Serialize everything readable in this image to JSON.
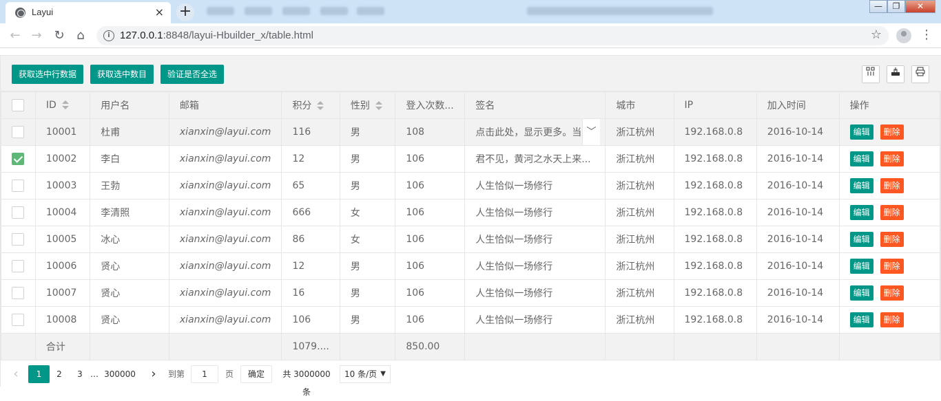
{
  "browser": {
    "tab_title": "Layui",
    "tab_close": "×",
    "new_tab": "+",
    "url_host": "127.0.0.1",
    "url_rest": ":8848/layui-Hbuilder_x/table.html",
    "win_min": "—",
    "win_max": "❐",
    "win_close": "✕"
  },
  "toolbar": {
    "btn_get_checked_data": "获取选中行数据",
    "btn_get_checked_count": "获取选中数目",
    "btn_check_all": "验证是否全选",
    "icon_filter": "filter-columns-icon",
    "icon_export": "export-icon",
    "icon_print": "print-icon"
  },
  "table": {
    "headers": [
      "ID",
      "用户名",
      "邮箱",
      "积分",
      "性别",
      "登入次数...",
      "签名",
      "城市",
      "IP",
      "加入时间",
      "操作"
    ],
    "rows": [
      {
        "checked": false,
        "id": "10001",
        "username": "杜甫",
        "email": "xianxin@layui.com",
        "score": "116",
        "sex": "男",
        "logins": "108",
        "sign": "点击此处，显示更多。当...",
        "city": "浙江杭州",
        "ip": "192.168.0.8",
        "joined": "2016-10-14"
      },
      {
        "checked": true,
        "id": "10002",
        "username": "李白",
        "email": "xianxin@layui.com",
        "score": "12",
        "sex": "男",
        "logins": "106",
        "sign": "君不见，黄河之水天上来...",
        "city": "浙江杭州",
        "ip": "192.168.0.8",
        "joined": "2016-10-14"
      },
      {
        "checked": false,
        "id": "10003",
        "username": "王勃",
        "email": "xianxin@layui.com",
        "score": "65",
        "sex": "男",
        "logins": "106",
        "sign": "人生恰似一场修行",
        "city": "浙江杭州",
        "ip": "192.168.0.8",
        "joined": "2016-10-14"
      },
      {
        "checked": false,
        "id": "10004",
        "username": "李清照",
        "email": "xianxin@layui.com",
        "score": "666",
        "sex": "女",
        "logins": "106",
        "sign": "人生恰似一场修行",
        "city": "浙江杭州",
        "ip": "192.168.0.8",
        "joined": "2016-10-14"
      },
      {
        "checked": false,
        "id": "10005",
        "username": "冰心",
        "email": "xianxin@layui.com",
        "score": "86",
        "sex": "女",
        "logins": "106",
        "sign": "人生恰似一场修行",
        "city": "浙江杭州",
        "ip": "192.168.0.8",
        "joined": "2016-10-14"
      },
      {
        "checked": false,
        "id": "10006",
        "username": "贤心",
        "email": "xianxin@layui.com",
        "score": "12",
        "sex": "男",
        "logins": "106",
        "sign": "人生恰似一场修行",
        "city": "浙江杭州",
        "ip": "192.168.0.8",
        "joined": "2016-10-14"
      },
      {
        "checked": false,
        "id": "10007",
        "username": "贤心",
        "email": "xianxin@layui.com",
        "score": "16",
        "sex": "男",
        "logins": "106",
        "sign": "人生恰似一场修行",
        "city": "浙江杭州",
        "ip": "192.168.0.8",
        "joined": "2016-10-14"
      },
      {
        "checked": false,
        "id": "10008",
        "username": "贤心",
        "email": "xianxin@layui.com",
        "score": "106",
        "sex": "男",
        "logins": "106",
        "sign": "人生恰似一场修行",
        "city": "浙江杭州",
        "ip": "192.168.0.8",
        "joined": "2016-10-14"
      }
    ],
    "edit_label": "编辑",
    "delete_label": "删除",
    "footer_total_label": "合计",
    "footer_score": "1079....",
    "footer_logins": "850.00"
  },
  "pager": {
    "prev": "‹",
    "pages": [
      "1",
      "2",
      "3"
    ],
    "ellipsis": "…",
    "last_page": "300000",
    "next": "›",
    "goto_label": "到第",
    "goto_value": "1",
    "page_label": "页",
    "confirm": "确定",
    "total": "共 3000000 条",
    "per_page": "10 条/页"
  },
  "colors": {
    "primary": "#009688",
    "danger": "#FF5722",
    "checked": "#5FB878"
  }
}
